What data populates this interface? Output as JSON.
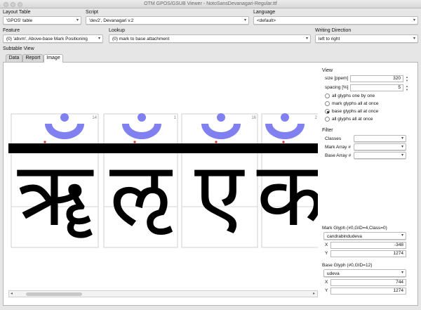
{
  "window": {
    "title": "OTM GPOS/GSUB Viewer - NotoSansDevanagari-Regular.ttf"
  },
  "toolbar": {
    "layout_table": {
      "label": "Layout Table",
      "value": "'GPOS' table"
    },
    "script": {
      "label": "Script",
      "value": "'dev2', Devanagari v.2"
    },
    "language": {
      "label": "Language",
      "value": "<default>"
    },
    "feature": {
      "label": "Feature",
      "value": "(0) 'abvm', Above-base Mark Positioning"
    },
    "lookup": {
      "label": "Lookup",
      "value": "(0) mark to base attachment"
    },
    "writing_direction": {
      "label": "Writing Direction",
      "value": "left to right"
    }
  },
  "subtable": {
    "label": "Subtable View",
    "tabs": [
      {
        "label": "Data"
      },
      {
        "label": "Report"
      },
      {
        "label": "Image",
        "active": true
      }
    ]
  },
  "glyph_cells": [
    {
      "index": "14",
      "glyph": "ॠ"
    },
    {
      "index": "1",
      "glyph": "ऌ"
    },
    {
      "index": "16",
      "glyph": "ए"
    },
    {
      "index": "2",
      "glyph": "क"
    }
  ],
  "view": {
    "label": "View",
    "size_label": "size [ppem]",
    "size_value": "320",
    "spacing_label": "spacing [%]",
    "spacing_value": "5",
    "options": [
      {
        "label": "all glyphs one by one",
        "selected": false
      },
      {
        "label": "mark glyphs all at once",
        "selected": false
      },
      {
        "label": "base glyphs all at once",
        "selected": true
      },
      {
        "label": "all glyphs all at once",
        "selected": false
      }
    ]
  },
  "filter": {
    "label": "Filter",
    "classes_label": "Classes",
    "classes_value": "",
    "mark_array_label": "Mark Array #",
    "mark_array_value": "",
    "base_array_label": "Base Array #",
    "base_array_value": ""
  },
  "mark_glyph": {
    "label": "Mark Glyph (#0,GID=4,Class=0)",
    "name": "candrabindudeva",
    "x_label": "X",
    "x_value": "-348",
    "y_label": "Y",
    "y_value": "1274"
  },
  "base_glyph": {
    "label": "Base Glyph (#0,GID=12)",
    "name": "udeva",
    "x_label": "X",
    "x_value": "744",
    "y_label": "Y",
    "y_value": "1274"
  },
  "colors": {
    "mark": "#8080f0",
    "anchor": "#e03030"
  }
}
